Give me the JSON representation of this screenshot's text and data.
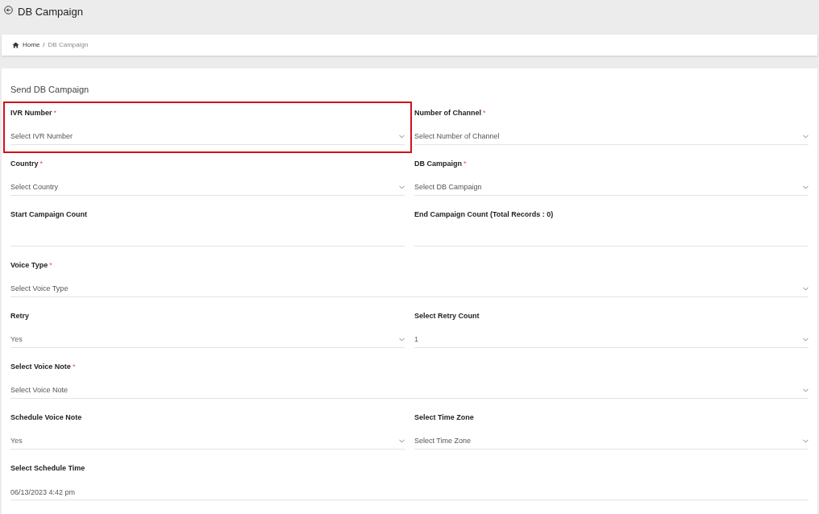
{
  "page_title": "DB Campaign",
  "breadcrumb": {
    "items": [
      "Home",
      "DB Campaign"
    ],
    "separator": "/"
  },
  "form": {
    "title": "Send DB Campaign",
    "rows": [
      [
        {
          "kind": "select",
          "label": "IVR Number",
          "required_mark": "*",
          "highlighted": true,
          "placeholder": "Select IVR Number"
        },
        {
          "kind": "select",
          "label": "Number of Channel",
          "required_mark": "*",
          "highlighted": false,
          "placeholder": "Select Number of Channel"
        }
      ],
      [
        {
          "kind": "select",
          "label": "Country",
          "required_mark": "*",
          "highlighted": false,
          "placeholder": "Select Country"
        },
        {
          "kind": "select",
          "label": "DB Campaign",
          "required_mark": "*",
          "highlighted": false,
          "placeholder": "Select DB Campaign"
        }
      ],
      [
        {
          "kind": "input",
          "label": "Start Campaign Count",
          "highlighted": false
        },
        {
          "kind": "input",
          "label": "End Campaign Count (Total Records : 0)",
          "highlighted": false
        }
      ],
      [
        {
          "kind": "select",
          "label": "Voice Type",
          "required_mark": "*",
          "highlighted": false,
          "placeholder": "Select Voice Type"
        }
      ],
      [
        {
          "kind": "select",
          "label": "Retry",
          "highlighted": false,
          "value": "Yes"
        },
        {
          "kind": "select",
          "label": "Select Retry Count",
          "highlighted": false,
          "value": "1"
        }
      ],
      [
        {
          "kind": "select",
          "label": "Select Voice Note",
          "required_mark": "*",
          "highlighted": false,
          "placeholder": "Select Voice Note"
        }
      ],
      [
        {
          "kind": "select",
          "label": "Schedule Voice Note",
          "highlighted": false,
          "value": "Yes"
        },
        {
          "kind": "select",
          "label": "Select Time Zone",
          "highlighted": false,
          "placeholder": "Select Time Zone"
        }
      ],
      [
        {
          "kind": "input",
          "label": "Select Schedule Time",
          "highlighted": false,
          "value": "06/13/2023 4:42 pm"
        }
      ]
    ]
  }
}
